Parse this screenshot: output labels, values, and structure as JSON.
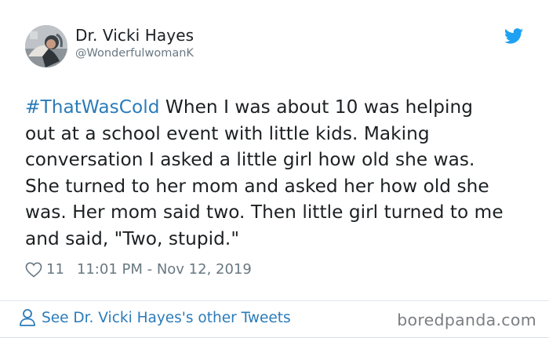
{
  "author": {
    "name": "Dr. Vicki Hayes",
    "handle": "@WonderfulwomanK",
    "avatar_icon": "profile-photo"
  },
  "platform_icon": "twitter-bird-icon",
  "tweet": {
    "hashtag": "#ThatWasCold",
    "body": "  When I was about 10 was helping\nout at a school event with little kids.  Making\nconversation I asked a little girl how old she was.\nShe turned to her mom and asked her how old she\nwas. Her mom said two. Then little girl turned to me\nand said, \"Two, stupid.\""
  },
  "meta": {
    "like_icon": "heart-icon",
    "likes": "11",
    "timestamp": "11:01 PM - Nov 12, 2019"
  },
  "footer": {
    "link_icon": "person-icon",
    "link_label": "See Dr. Vicki Hayes's other Tweets",
    "watermark": "boredpanda.com"
  },
  "colors": {
    "accent": "#2b7bb9",
    "text": "#1c2022",
    "muted": "#697882",
    "twitter_blue": "#1da1f2"
  }
}
